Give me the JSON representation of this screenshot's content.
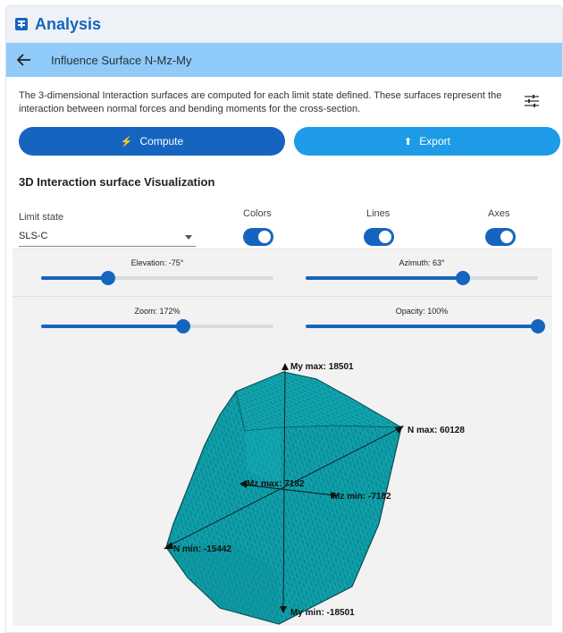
{
  "app": {
    "title": "Analysis",
    "icon": "calculator-icon"
  },
  "subheader": {
    "title": "Influence Surface N-Mz-My",
    "back_icon": "arrow-left-icon"
  },
  "description": "The 3-dimensional Interaction surfaces are computed for each limit state defined. These surfaces represent the interaction between normal forces and bending moments for the cross-section.",
  "settings_icon": "tune-icon",
  "buttons": {
    "compute": {
      "label": "Compute",
      "icon": "bolt-icon",
      "color": "#1565c0"
    },
    "export": {
      "label": "Export",
      "icon": "upload-icon",
      "color": "#1e9be6"
    }
  },
  "section_title": "3D Interaction surface Visualization",
  "limit_state": {
    "label": "Limit state",
    "value": "SLS-C"
  },
  "toggles": {
    "colors": {
      "label": "Colors",
      "on": true
    },
    "lines": {
      "label": "Lines",
      "on": true
    },
    "axes": {
      "label": "Axes",
      "on": true
    }
  },
  "sliders": {
    "elevation": {
      "label": "Elevation: -75°",
      "fraction": 0.29
    },
    "azimuth": {
      "label": "Azimuth: 63°",
      "fraction": 0.675
    },
    "zoom": {
      "label": "Zoom: 172%",
      "fraction": 0.61
    },
    "opacity": {
      "label": "Opacity: 100%",
      "fraction": 1.0
    }
  },
  "viz": {
    "surface_color": "#0fa3ad",
    "axes": {
      "my_max": "My max: 18501",
      "my_min": "My min: -18501",
      "n_max": "N max: 60128",
      "n_min": "N min: -15442",
      "mz_max": "Mz max: 7182",
      "mz_min": "Mz min: -7182"
    }
  }
}
